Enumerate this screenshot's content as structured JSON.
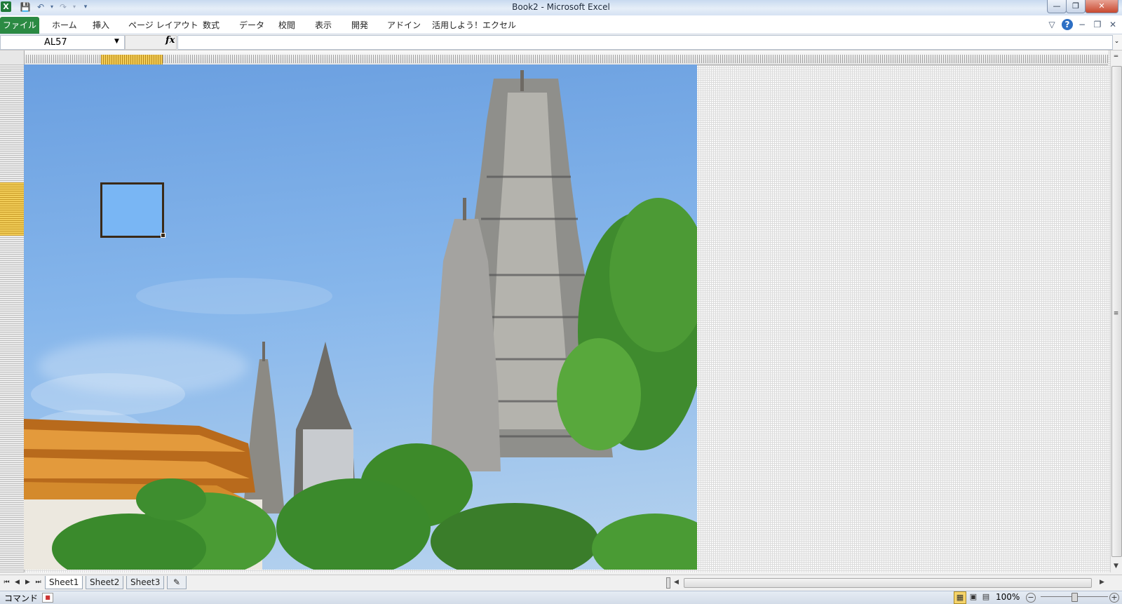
{
  "app": {
    "title": "Book2 - Microsoft Excel",
    "logo_letter": "X"
  },
  "quick_access": [
    {
      "name": "save-icon",
      "glyph": "🖫"
    },
    {
      "name": "undo-icon",
      "glyph": "↶"
    },
    {
      "name": "redo-icon",
      "glyph": "↷"
    },
    {
      "name": "customize-icon",
      "glyph": "▾"
    }
  ],
  "window_buttons": {
    "minimize": "—",
    "restore": "❐",
    "close": "✕"
  },
  "ribbon": {
    "tabs": [
      "ファイル",
      "ホーム",
      "挿入",
      "ページ レイアウト",
      "数式",
      "データ",
      "校閲",
      "表示",
      "開発",
      "アドイン",
      "活用しよう！エクセル"
    ],
    "right_icons": {
      "collapse": "▽",
      "help": "?",
      "minimize": "−",
      "restore": "❐",
      "close": "✕"
    }
  },
  "formula_bar": {
    "name_box": "AL57",
    "fx_label": "fx",
    "formula": "",
    "expand_glyph": "⌄"
  },
  "sheet_nav": {
    "first": "⏮",
    "prev": "◀",
    "next": "▶",
    "last": "⏭"
  },
  "sheets": [
    "Sheet1",
    "Sheet2",
    "Sheet3"
  ],
  "insert_sheet_glyph": "✎",
  "status": {
    "mode": "コマンド",
    "zoom": "100%",
    "zoom_level": 0.5,
    "zoom_out": "−",
    "zoom_in": "+",
    "view_normal": "▦",
    "view_layout": "▣",
    "view_break": "▤"
  },
  "colors": {
    "file_tab": "#2b8a43",
    "selection_header": "#f2cd58",
    "selected_cell_border": "#3a2a18"
  }
}
